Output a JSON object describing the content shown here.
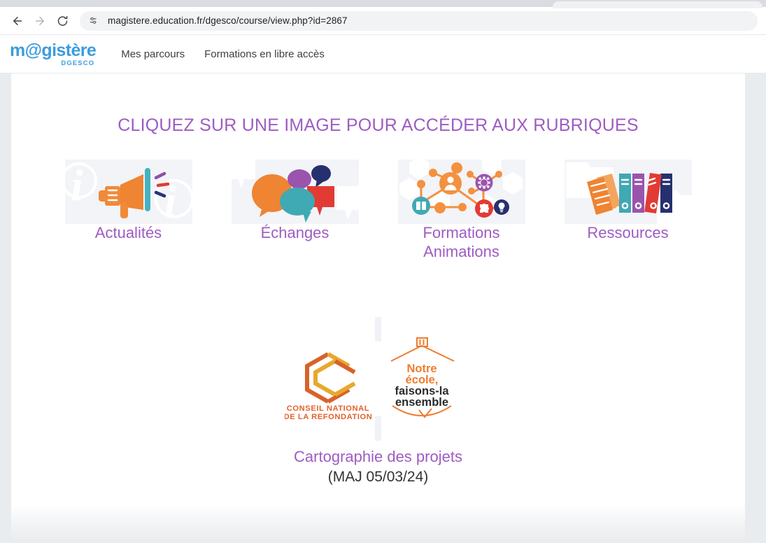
{
  "browser": {
    "back_icon": "back-arrow-icon",
    "forward_icon": "forward-arrow-icon",
    "reload_icon": "reload-icon",
    "site_settings_icon": "site-settings-sliders-icon",
    "url": "magistere.education.fr/dgesco/course/view.php?id=2867"
  },
  "site_header": {
    "logo_word": "m@gistère",
    "logo_sub": "DGESCO",
    "logo_color": "#3c9cdd",
    "nav": [
      {
        "label": "Mes parcours"
      },
      {
        "label": "Formations en libre accès"
      }
    ]
  },
  "main": {
    "section_title": "CLIQUEZ SUR UNE IMAGE POUR ACCÉDER AUX RUBRIQUES",
    "accent_color": "#9e5cc2",
    "tiles": [
      {
        "label": "Actualités",
        "icon": "megaphone-icon"
      },
      {
        "label": "Échanges",
        "icon": "speech-bubbles-icon"
      },
      {
        "label": "Formations\nAnimations",
        "icon": "network-nodes-icon"
      },
      {
        "label": "Ressources",
        "icon": "binders-documents-icon"
      }
    ],
    "carto": {
      "logo_cnr_line1": "CONSEIL NATIONAL",
      "logo_cnr_line2": "DE LA REFONDATION",
      "slogan_line1": "Notre",
      "slogan_line2": "école,",
      "slogan_line3": "faisons-la",
      "slogan_line4": "ensemble",
      "title": "Cartographie des projets",
      "subtitle": "(MAJ 05/03/24)",
      "brand_orange": "#ef7d2f",
      "brand_yellow": "#e8a82e"
    }
  }
}
